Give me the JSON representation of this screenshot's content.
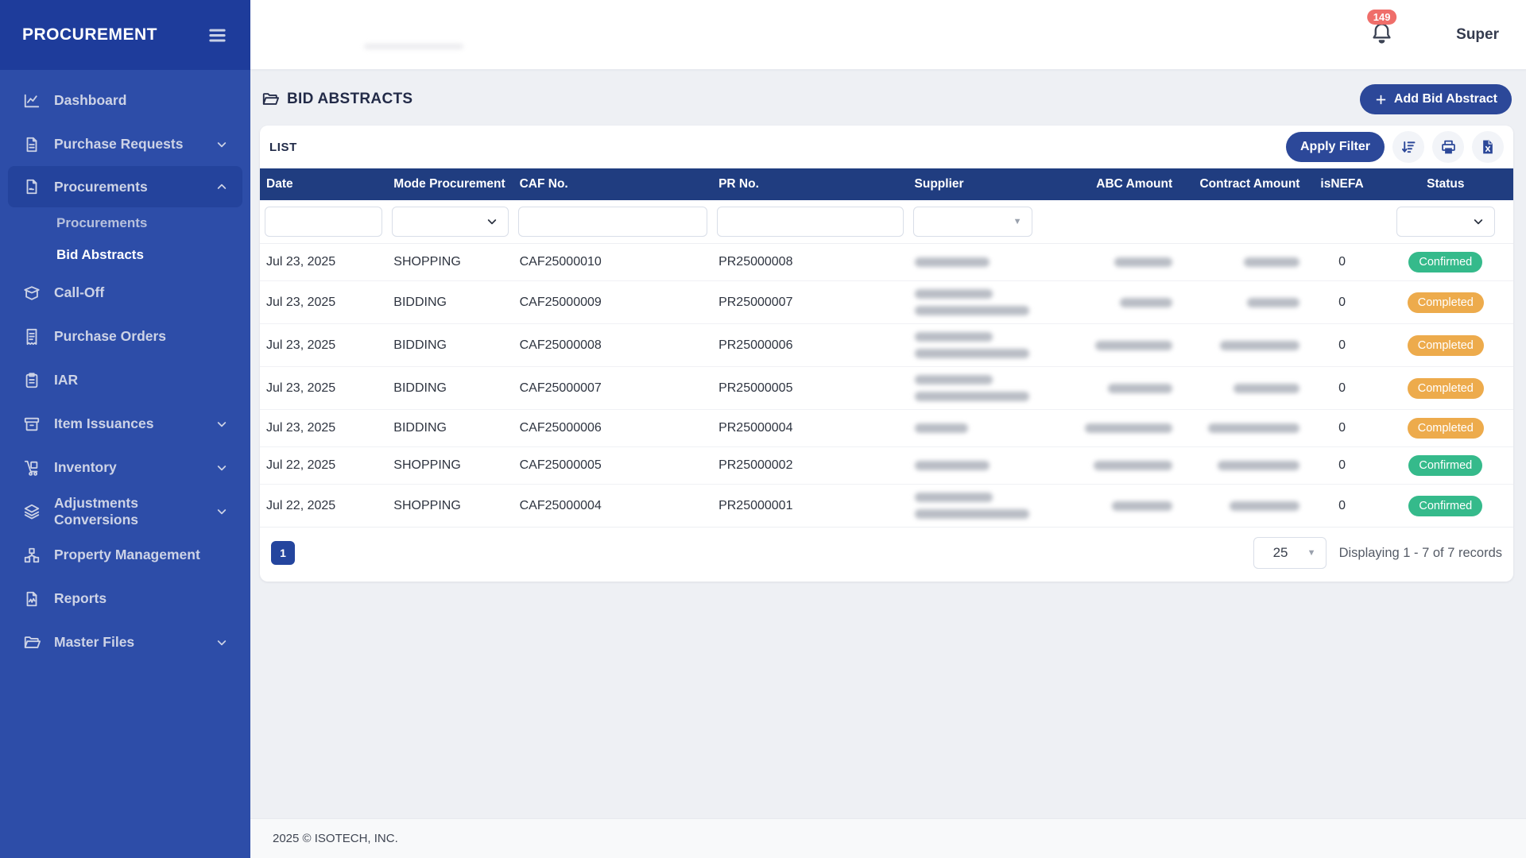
{
  "colors": {
    "sidebar_bg": "#2d4da8",
    "sidebar_header_bg": "#1e3c9b",
    "primary_button": "#2c4899",
    "table_header_bg": "#203d80",
    "badge_confirmed": "#35ba8b",
    "badge_completed": "#edab4c",
    "notification_badge": "#ef6e6a"
  },
  "sidebar": {
    "brand": "PROCUREMENT",
    "items": [
      {
        "label": "Dashboard",
        "icon": "chart-line-icon"
      },
      {
        "label": "Purchase Requests",
        "icon": "file-lines-icon",
        "chevron": "down"
      },
      {
        "label": "Procurements",
        "icon": "file-signature-icon",
        "chevron": "up",
        "active": true
      },
      {
        "label": "Procurements",
        "sub": true
      },
      {
        "label": "Bid Abstracts",
        "sub": true,
        "active": true
      },
      {
        "label": "Call-Off",
        "icon": "box-open-icon"
      },
      {
        "label": "Purchase Orders",
        "icon": "receipt-icon"
      },
      {
        "label": "IAR",
        "icon": "clipboard-list-icon"
      },
      {
        "label": "Item Issuances",
        "icon": "box-archive-icon",
        "chevron": "down"
      },
      {
        "label": "Inventory",
        "icon": "dolly-icon",
        "chevron": "down"
      },
      {
        "label": "Adjustments Conversions",
        "icon": "layers-icon",
        "chevron": "down"
      },
      {
        "label": "Property Management",
        "icon": "blocks-icon"
      },
      {
        "label": "Reports",
        "icon": "file-chart-icon"
      },
      {
        "label": "Master Files",
        "icon": "folder-open-icon",
        "chevron": "down"
      }
    ]
  },
  "header": {
    "notification_count": "149",
    "user_name": "Super"
  },
  "page": {
    "title": "BID ABSTRACTS",
    "add_button_label": "Add Bid Abstract"
  },
  "list_card": {
    "title": "LIST",
    "apply_filter_label": "Apply Filter",
    "toolbar_icons": [
      "sort-amount-down-icon",
      "print-icon",
      "file-excel-icon"
    ],
    "columns": [
      "Date",
      "Mode Procurement",
      "CAF No.",
      "PR No.",
      "Supplier",
      "ABC Amount",
      "Contract Amount",
      "isNEFA",
      "Status"
    ],
    "rows": [
      {
        "date": "Jul 23, 2025",
        "mode": "SHOPPING",
        "caf_no": "CAF25000010",
        "pr_no": "PR25000008",
        "supplier_masked_line_widths": [
          94
        ],
        "abc_amount_masked_width": 73,
        "contract_amount_masked_width": 70,
        "is_nefa": "0",
        "status": "Confirmed"
      },
      {
        "date": "Jul 23, 2025",
        "mode": "BIDDING",
        "caf_no": "CAF25000009",
        "pr_no": "PR25000007",
        "supplier_masked_line_widths": [
          98,
          144
        ],
        "abc_amount_masked_width": 66,
        "contract_amount_masked_width": 66,
        "is_nefa": "0",
        "status": "Completed"
      },
      {
        "date": "Jul 23, 2025",
        "mode": "BIDDING",
        "caf_no": "CAF25000008",
        "pr_no": "PR25000006",
        "supplier_masked_line_widths": [
          98,
          144
        ],
        "abc_amount_masked_width": 97,
        "contract_amount_masked_width": 100,
        "is_nefa": "0",
        "status": "Completed"
      },
      {
        "date": "Jul 23, 2025",
        "mode": "BIDDING",
        "caf_no": "CAF25000007",
        "pr_no": "PR25000005",
        "supplier_masked_line_widths": [
          98,
          144
        ],
        "abc_amount_masked_width": 81,
        "contract_amount_masked_width": 83,
        "is_nefa": "0",
        "status": "Completed"
      },
      {
        "date": "Jul 23, 2025",
        "mode": "BIDDING",
        "caf_no": "CAF25000006",
        "pr_no": "PR25000004",
        "supplier_masked_line_widths": [
          67
        ],
        "abc_amount_masked_width": 110,
        "contract_amount_masked_width": 115,
        "is_nefa": "0",
        "status": "Completed"
      },
      {
        "date": "Jul 22, 2025",
        "mode": "SHOPPING",
        "caf_no": "CAF25000005",
        "pr_no": "PR25000002",
        "supplier_masked_line_widths": [
          94
        ],
        "abc_amount_masked_width": 99,
        "contract_amount_masked_width": 103,
        "is_nefa": "0",
        "status": "Confirmed"
      },
      {
        "date": "Jul 22, 2025",
        "mode": "SHOPPING",
        "caf_no": "CAF25000004",
        "pr_no": "PR25000001",
        "supplier_masked_line_widths": [
          98,
          144
        ],
        "abc_amount_masked_width": 76,
        "contract_amount_masked_width": 88,
        "is_nefa": "0",
        "status": "Confirmed"
      }
    ],
    "pagination": {
      "current_page": "1",
      "page_size": "25",
      "summary": "Displaying 1 - 7 of 7 records"
    }
  },
  "footer": {
    "copyright": "2025 © ISOTECH, INC."
  }
}
